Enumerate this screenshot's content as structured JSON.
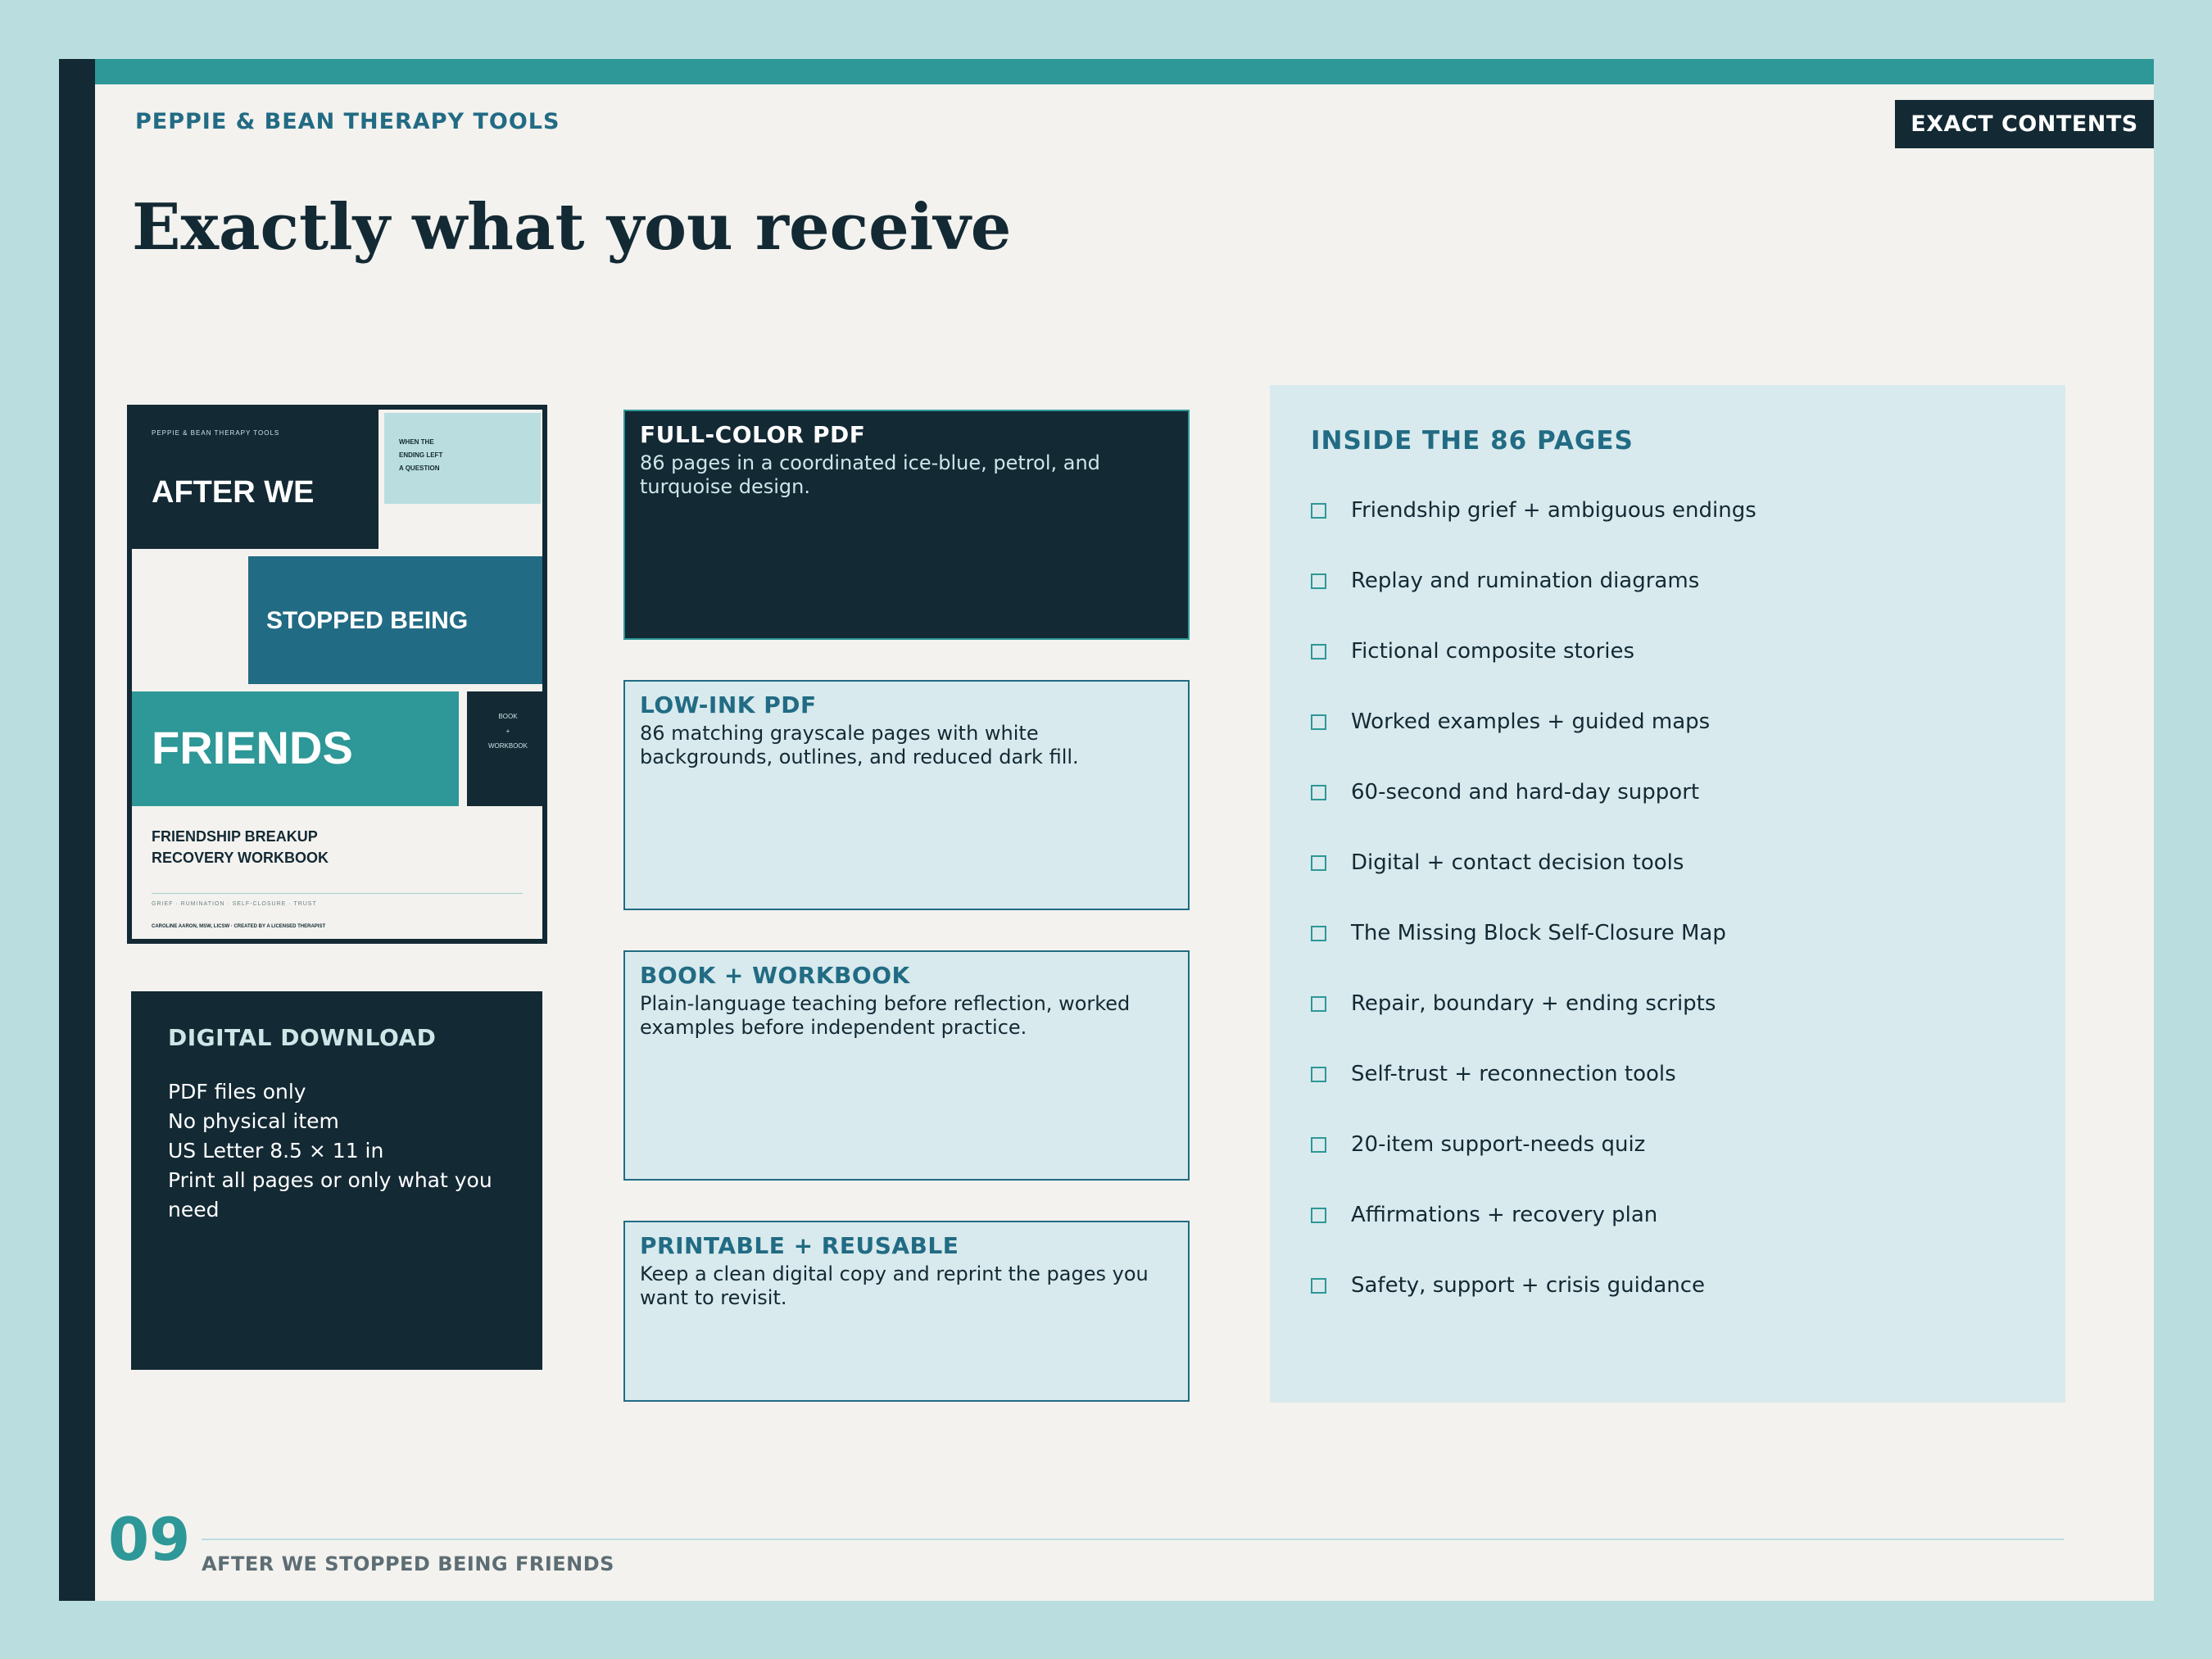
{
  "brand": "PEPPIE & BEAN THERAPY TOOLS",
  "tag": "EXACT CONTENTS",
  "title": "Exactly what you receive",
  "cover": {
    "brand": "PEPPIE & BEAN THERAPY TOOLS",
    "question": [
      "WHEN THE",
      "ENDING LEFT",
      "A QUESTION"
    ],
    "title_1": "AFTER WE",
    "title_2": "STOPPED BEING",
    "title_3": "FRIENDS",
    "badge": [
      "BOOK",
      "+",
      "WORKBOOK"
    ],
    "subtitle_1": "FRIENDSHIP BREAKUP",
    "subtitle_2": "RECOVERY WORKBOOK",
    "keywords": "GRIEF · RUMINATION · SELF-CLOSURE · TRUST",
    "author": "CAROLINE AARON, MSW, LICSW · CREATED BY A LICENSED THERAPIST"
  },
  "download": {
    "heading": "DIGITAL DOWNLOAD",
    "lines": [
      "PDF files only",
      "No physical item",
      "US Letter 8.5 × 11 in",
      "Print all pages or only what you need"
    ]
  },
  "cards": [
    {
      "heading": "FULL-COLOR PDF",
      "body": "86 pages in a coordinated ice-blue, petrol, and turquoise design."
    },
    {
      "heading": "LOW-INK PDF",
      "body": "86 matching grayscale pages with white backgrounds, outlines, and reduced dark fill."
    },
    {
      "heading": "BOOK + WORKBOOK",
      "body": "Plain-language teaching before reflection, worked examples before independent practice."
    },
    {
      "heading": "PRINTABLE + REUSABLE",
      "body": "Keep a clean digital copy and reprint the pages you want to revisit."
    }
  ],
  "inside": {
    "heading": "INSIDE THE 86 PAGES",
    "items": [
      "Friendship grief + ambiguous endings",
      "Replay and rumination diagrams",
      "Fictional composite stories",
      "Worked examples + guided maps",
      "60-second and hard-day support",
      "Digital + contact decision tools",
      "The Missing Block Self-Closure Map",
      "Repair, boundary + ending scripts",
      "Self-trust + reconnection tools",
      "20-item support-needs quiz",
      "Affirmations + recovery plan",
      "Safety, support + crisis guidance"
    ]
  },
  "footer": {
    "page_number": "09",
    "text": "AFTER WE STOPPED BEING FRIENDS"
  }
}
